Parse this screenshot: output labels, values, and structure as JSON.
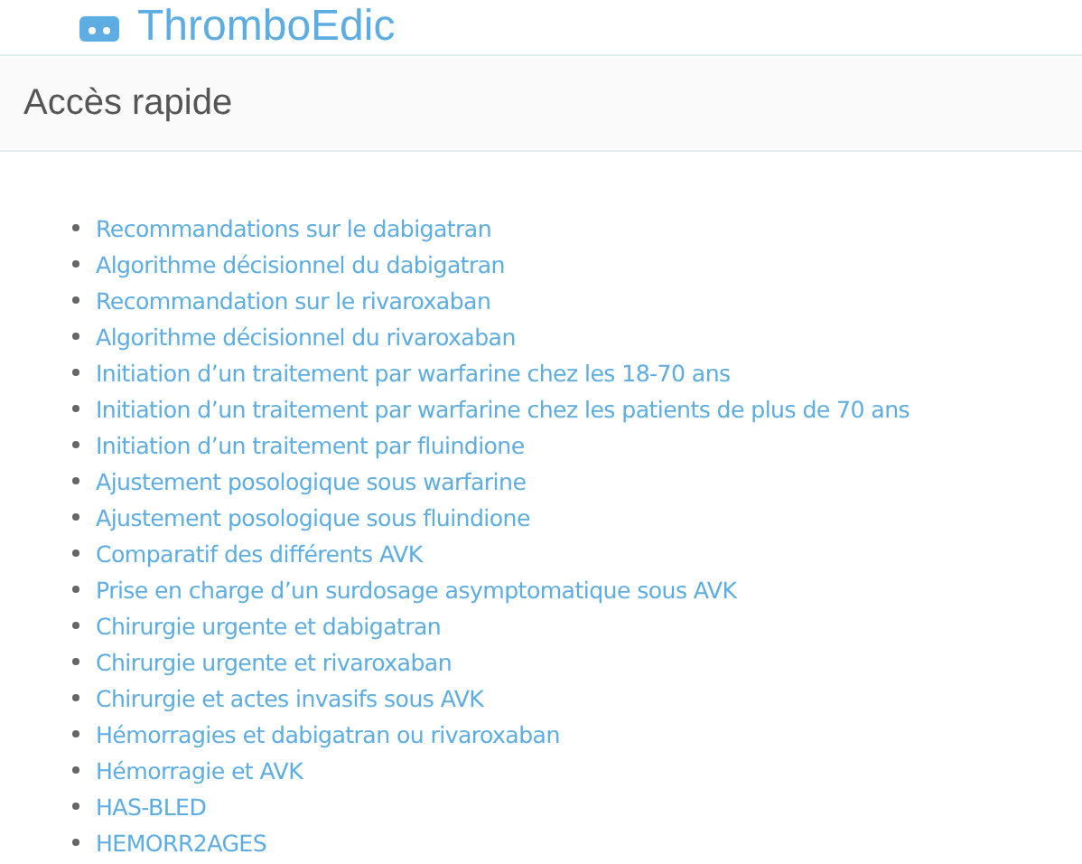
{
  "site": {
    "title": "ThromboEdic"
  },
  "section": {
    "title": "Accès rapide"
  },
  "links": [
    "Recommandations sur le dabigatran",
    "Algorithme décisionnel du dabigatran",
    "Recommandation sur le rivaroxaban",
    "Algorithme décisionnel du rivaroxaban",
    "Initiation d’un traitement par warfarine chez les 18-70 ans",
    "Initiation d’un traitement par warfarine chez les patients de plus de 70 ans",
    "Initiation d’un traitement par fluindione",
    "Ajustement posologique sous warfarine",
    "Ajustement posologique sous fluindione",
    "Comparatif des différents AVK",
    "Prise en charge d’un surdosage asymptomatique sous AVK",
    "Chirurgie urgente et dabigatran",
    "Chirurgie urgente et rivaroxaban",
    "Chirurgie et actes invasifs sous AVK",
    "Hémorragies et dabigatran ou rivaroxaban",
    "Hémorragie et AVK",
    "HAS-BLED",
    "HEMORR2AGES"
  ]
}
